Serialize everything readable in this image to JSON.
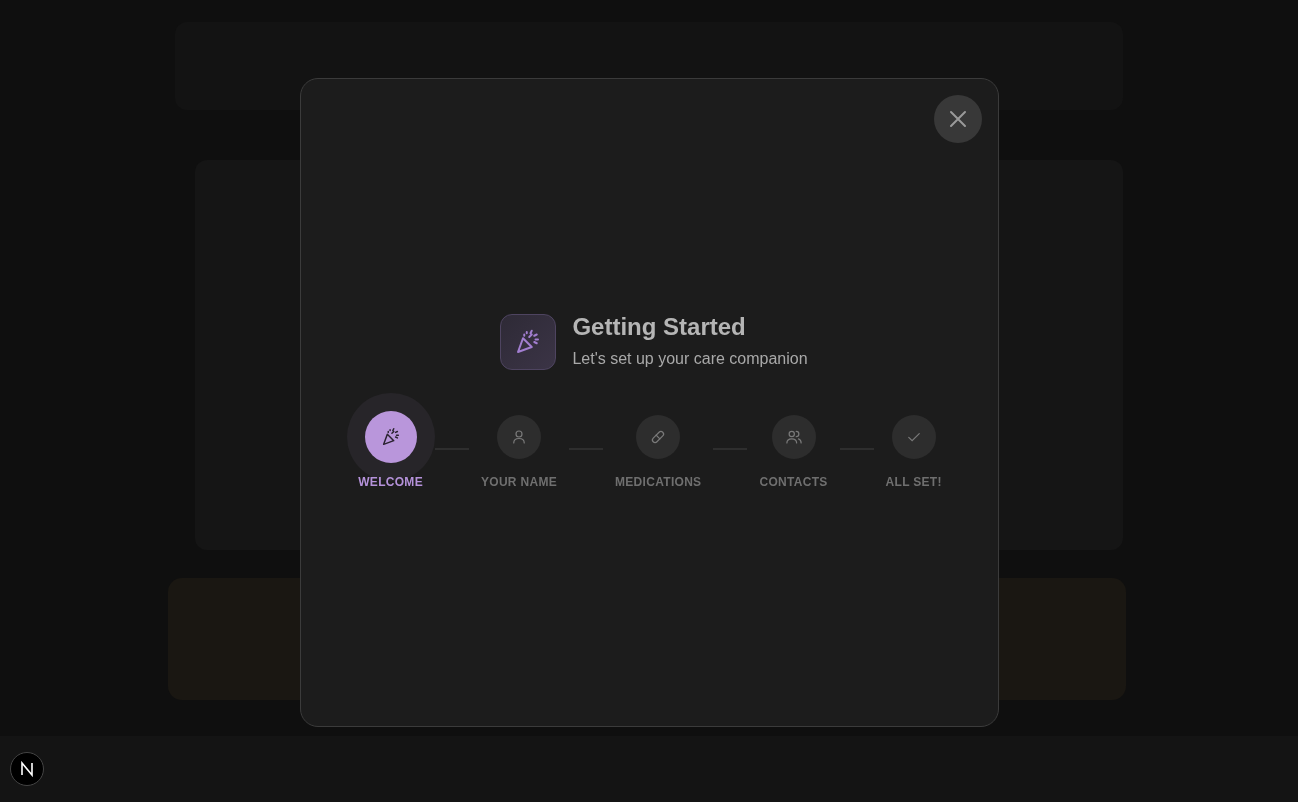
{
  "dialog": {
    "title": "Getting Started",
    "subtitle": "Let's set up your care companion",
    "steps": [
      {
        "label": "WELCOME",
        "selected": true
      },
      {
        "label": "YOUR NAME",
        "selected": false
      },
      {
        "label": "MEDICATIONS",
        "selected": false
      },
      {
        "label": "CONTACTS",
        "selected": false
      },
      {
        "label": "ALL SET!",
        "selected": false
      }
    ]
  }
}
